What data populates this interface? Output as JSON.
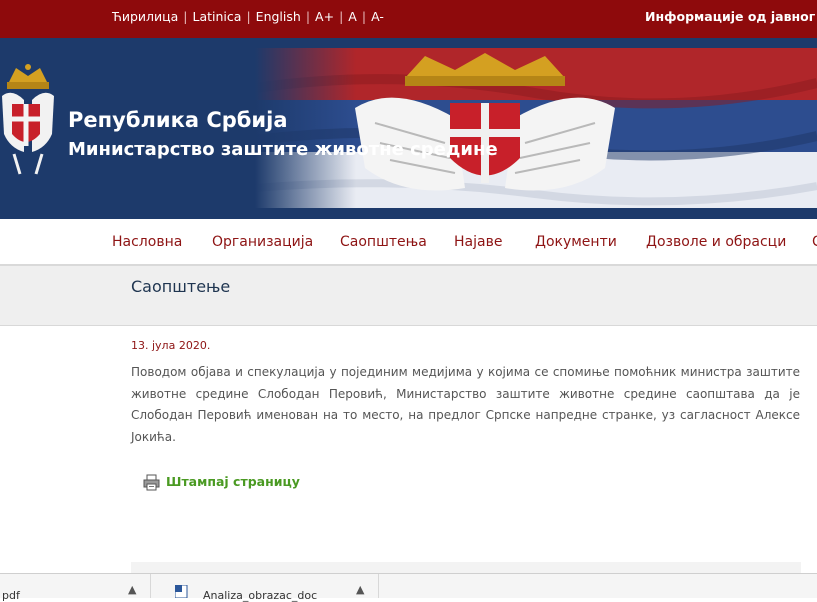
{
  "topbar": {
    "languages": [
      "Ћирилица",
      "Latinica",
      "English"
    ],
    "font_controls": [
      "A+",
      "A",
      "A-"
    ],
    "info_link": "Информације од јавног знач"
  },
  "header": {
    "title": "Република Србија",
    "subtitle": "Министарство заштите животне средине"
  },
  "nav": {
    "items": [
      "Насловна",
      "Организација",
      "Саопштења",
      "Најаве",
      "Документи",
      "Дозволе и обрасци",
      "С"
    ]
  },
  "page": {
    "title": "Саопштење",
    "date": "13. јула 2020.",
    "body": "Поводом објава и спекулација у појединим медијима у којима се спомиње помоћник министра заштите животне средине Слободан Перовић,  Министарство заштите животне средине саопштава да је Слободан Перовић именован на то место, на предлог Српске напредне странке, уз сагласност Алексе Јокића.",
    "print_label": "Штампај страницу"
  },
  "downloads": {
    "items": [
      {
        "name": "pdf",
        "icon": "chevron-up-icon"
      },
      {
        "name": "Analiza_obrazac_doc",
        "icon": "word-file-icon"
      }
    ]
  },
  "colors": {
    "topbar": "#8e0a0c",
    "banner": "#1d3a6b",
    "nav_text": "#8e1414",
    "print_link": "#4a9a22"
  }
}
